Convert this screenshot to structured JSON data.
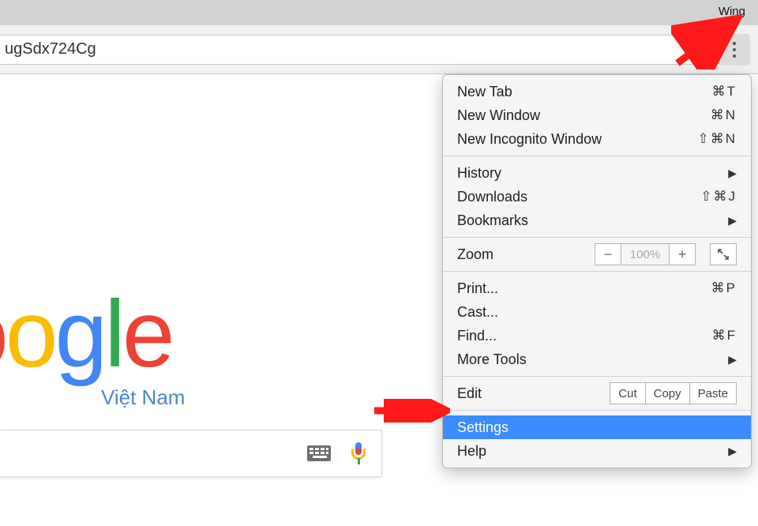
{
  "titlebar": {
    "user": "Wing"
  },
  "toolbar": {
    "url_fragment": "ugSdx724Cg"
  },
  "logo": {
    "chars": [
      {
        "c": "o",
        "cls": "l-red"
      },
      {
        "c": "o",
        "cls": "l-yellow"
      },
      {
        "c": "g",
        "cls": "l-blue"
      },
      {
        "c": "l",
        "cls": "l-green"
      },
      {
        "c": "e",
        "cls": "l-red"
      }
    ],
    "subtitle": "Việt Nam"
  },
  "menu": {
    "sections": [
      [
        {
          "label": "New Tab",
          "shortcut": "⌘T"
        },
        {
          "label": "New Window",
          "shortcut": "⌘N"
        },
        {
          "label": "New Incognito Window",
          "shortcut": "⇧⌘N"
        }
      ],
      [
        {
          "label": "History",
          "submenu": true
        },
        {
          "label": "Downloads",
          "shortcut": "⇧⌘J"
        },
        {
          "label": "Bookmarks",
          "submenu": true
        }
      ],
      [
        {
          "label": "Zoom",
          "zoom": {
            "value": "100%"
          }
        }
      ],
      [
        {
          "label": "Print...",
          "shortcut": "⌘P"
        },
        {
          "label": "Cast..."
        },
        {
          "label": "Find...",
          "shortcut": "⌘F"
        },
        {
          "label": "More Tools",
          "submenu": true
        }
      ],
      [
        {
          "label": "Edit",
          "edit": {
            "cut": "Cut",
            "copy": "Copy",
            "paste": "Paste"
          }
        }
      ],
      [
        {
          "label": "Settings",
          "highlight": true
        },
        {
          "label": "Help",
          "submenu": true
        }
      ]
    ]
  }
}
